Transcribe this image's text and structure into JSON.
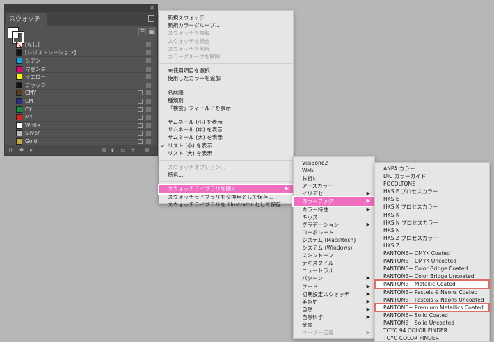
{
  "panel": {
    "title": "スウォッチ",
    "swatches": [
      {
        "label": "[なし]",
        "color": "none"
      },
      {
        "label": "[レジストレーション]",
        "color": "#111111"
      },
      {
        "label": "シアン",
        "color": "#00a8e8"
      },
      {
        "label": "マゼンタ",
        "color": "#e5007f"
      },
      {
        "label": "イエロー",
        "color": "#fff100"
      },
      {
        "label": "ブラック",
        "color": "#111111"
      },
      {
        "label": "CMY",
        "color": "#5a3b1e"
      },
      {
        "label": "CM",
        "color": "#2d2a8f"
      },
      {
        "label": "CY",
        "color": "#0f8f3c"
      },
      {
        "label": "MY",
        "color": "#e0201b"
      },
      {
        "label": "White",
        "color": "#ffffff"
      },
      {
        "label": "Silver",
        "color": "#b9b9b9"
      },
      {
        "label": "Gold",
        "color": "#c9a437"
      }
    ]
  },
  "main_menu": {
    "groups": [
      [
        {
          "label": "新規スウォッチ...",
          "disabled": false
        },
        {
          "label": "新規カラーグループ...",
          "disabled": false
        },
        {
          "label": "スウォッチを複製",
          "disabled": true
        },
        {
          "label": "スウォッチを統合",
          "disabled": true
        },
        {
          "label": "スウォッチを削除",
          "disabled": true
        },
        {
          "label": "カラーグループを解除...",
          "disabled": true
        }
      ],
      [
        {
          "label": "未使用項目を選択",
          "disabled": false
        },
        {
          "label": "使用したカラーを追加",
          "disabled": false
        }
      ],
      [
        {
          "label": "名前順",
          "disabled": false
        },
        {
          "label": "種類別",
          "disabled": false
        },
        {
          "label": "「検索」フィールドを表示",
          "disabled": false
        }
      ],
      [
        {
          "label": "サムネール (小) を表示",
          "disabled": false
        },
        {
          "label": "サムネール (中) を表示",
          "disabled": false
        },
        {
          "label": "サムネール (大) を表示",
          "disabled": false
        },
        {
          "label": "リスト (小) を表示",
          "disabled": false,
          "checked": true
        },
        {
          "label": "リスト (大) を表示",
          "disabled": false
        }
      ],
      [
        {
          "label": "スウォッチオプション...",
          "disabled": true
        },
        {
          "label": "特色...",
          "disabled": false
        }
      ],
      [
        {
          "label": "スウォッチライブラリを開く",
          "disabled": false,
          "active": true,
          "submenu": true
        },
        {
          "label": "スウォッチライブラリを交換用として保存...",
          "disabled": false
        },
        {
          "label": "スウォッチライブラリを Illustrator として保存...",
          "disabled": false
        }
      ]
    ],
    "check_mark": "✓",
    "arrow": "▶"
  },
  "library_menu": {
    "items": [
      {
        "label": "VisiBone2"
      },
      {
        "label": "Web"
      },
      {
        "label": "お祝い"
      },
      {
        "label": "アースカラー"
      },
      {
        "label": "イリデセ",
        "submenu": true
      },
      {
        "label": "カラーブック",
        "submenu": true,
        "active": true
      },
      {
        "label": "カラー特性",
        "submenu": true
      },
      {
        "label": "キッズ"
      },
      {
        "label": "グラデーション",
        "submenu": true
      },
      {
        "label": "コーポレート"
      },
      {
        "label": "システム (Macintosh)"
      },
      {
        "label": "システム (Windows)"
      },
      {
        "label": "スキントーン"
      },
      {
        "label": "テキスタイル"
      },
      {
        "label": "ニュートラル"
      },
      {
        "label": "パターン",
        "submenu": true
      },
      {
        "label": "フード",
        "submenu": true
      },
      {
        "label": "初期設定スウォッチ",
        "submenu": true
      },
      {
        "label": "美術史",
        "submenu": true
      },
      {
        "label": "自然",
        "submenu": true
      },
      {
        "label": "自然科学",
        "submenu": true
      },
      {
        "label": "金属"
      },
      {
        "label": "ユーザー定義",
        "submenu": true,
        "disabled": true
      }
    ]
  },
  "colorbook_menu": {
    "items": [
      {
        "label": "ANPA カラー"
      },
      {
        "label": "DIC カラーガイド"
      },
      {
        "label": "FOCOLTONE"
      },
      {
        "label": "HKS E プロセスカラー"
      },
      {
        "label": "HKS E"
      },
      {
        "label": "HKS K プロセスカラー"
      },
      {
        "label": "HKS K"
      },
      {
        "label": "HKS N プロセスカラー"
      },
      {
        "label": "HKS N"
      },
      {
        "label": "HKS Z プロセスカラー"
      },
      {
        "label": "HKS Z"
      },
      {
        "label": "PANTONE+ CMYK Coated"
      },
      {
        "label": "PANTONE+ CMYK Uncoated"
      },
      {
        "label": "PANTONE+ Color Bridge Coated"
      },
      {
        "label": "PANTONE+ Color Bridge Uncoated"
      },
      {
        "label": "PANTONE+ Metallic Coated",
        "highlight": true
      },
      {
        "label": "PANTONE+ Pastels & Neons Coated"
      },
      {
        "label": "PANTONE+ Pastels & Neons Uncoated"
      },
      {
        "label": "PANTONE+ Premium Metallics Coated",
        "highlight": true
      },
      {
        "label": "PANTONE+ Solid Coated"
      },
      {
        "label": "PANTONE+ Solid Uncoated"
      },
      {
        "label": "TOYO 94 COLOR FINDER"
      },
      {
        "label": "TOYO COLOR FINDER"
      }
    ]
  },
  "colors": {
    "active_item": "#f06ec0",
    "highlight_box": "#e56a6a",
    "backdrop": "#b7b7b7"
  }
}
